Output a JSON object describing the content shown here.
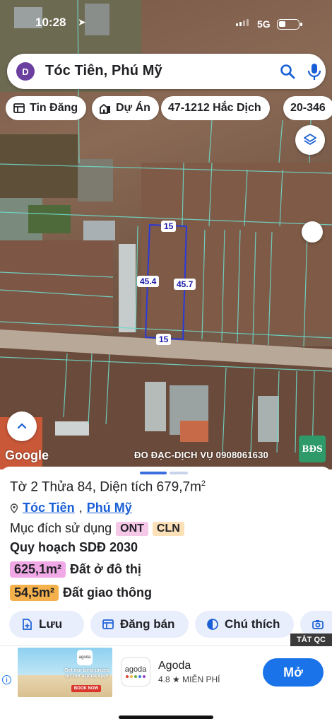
{
  "status_bar": {
    "time": "10:28",
    "network": "5G"
  },
  "search": {
    "avatar_letter": "D",
    "query": "Tóc Tiên, Phú Mỹ"
  },
  "chips": [
    {
      "label": "Tin Đăng",
      "icon": "listing-icon"
    },
    {
      "label": "Dự Án",
      "icon": "buildings-icon"
    },
    {
      "label": "47-1212 Hắc Dịch",
      "icon": ""
    },
    {
      "label": "20-346",
      "icon": ""
    }
  ],
  "map": {
    "plot_dimensions": {
      "top": "15",
      "bottom": "15",
      "left": "45.4",
      "right": "45.7"
    },
    "attribution": "Google",
    "watermark": "ĐO ĐẠC-DỊCH VỤ 0908061630",
    "badge_text": "BĐS"
  },
  "parcel": {
    "title": "Tờ 2 Thửa 84, Diện tích 679,7m",
    "title_sup": "2",
    "address_ward": "Tóc Tiên",
    "address_comma": ",",
    "address_town": "Phú Mỹ",
    "purpose_label": "Mục đích sử dụng",
    "purpose_tags": [
      "ONT",
      "CLN"
    ],
    "plan_title": "Quy hoạch SDĐ 2030",
    "areas": [
      {
        "value": "625,1m²",
        "label": "Đất ở đô thị",
        "color": "#f0a8e6"
      },
      {
        "value": "54,5m²",
        "label": "Đất giao thông",
        "color": "#f5b14c"
      }
    ]
  },
  "actions": [
    {
      "label": "Lưu",
      "icon": "save-icon"
    },
    {
      "label": "Đăng bán",
      "icon": "post-icon"
    },
    {
      "label": "Chú thích",
      "icon": "legend-icon"
    },
    {
      "label": "",
      "icon": "camera-icon"
    }
  ],
  "ad": {
    "close_label": "TẮT QC",
    "banner_text": "Get our best prices on the Agoda app!",
    "banner_cta": "BOOK NOW",
    "banner_logo": "agoda",
    "app_name": "Agoda",
    "rating": "4.8",
    "price": "MIỄN PHÍ",
    "install_label": "Mở",
    "icon_text": "agoda"
  }
}
